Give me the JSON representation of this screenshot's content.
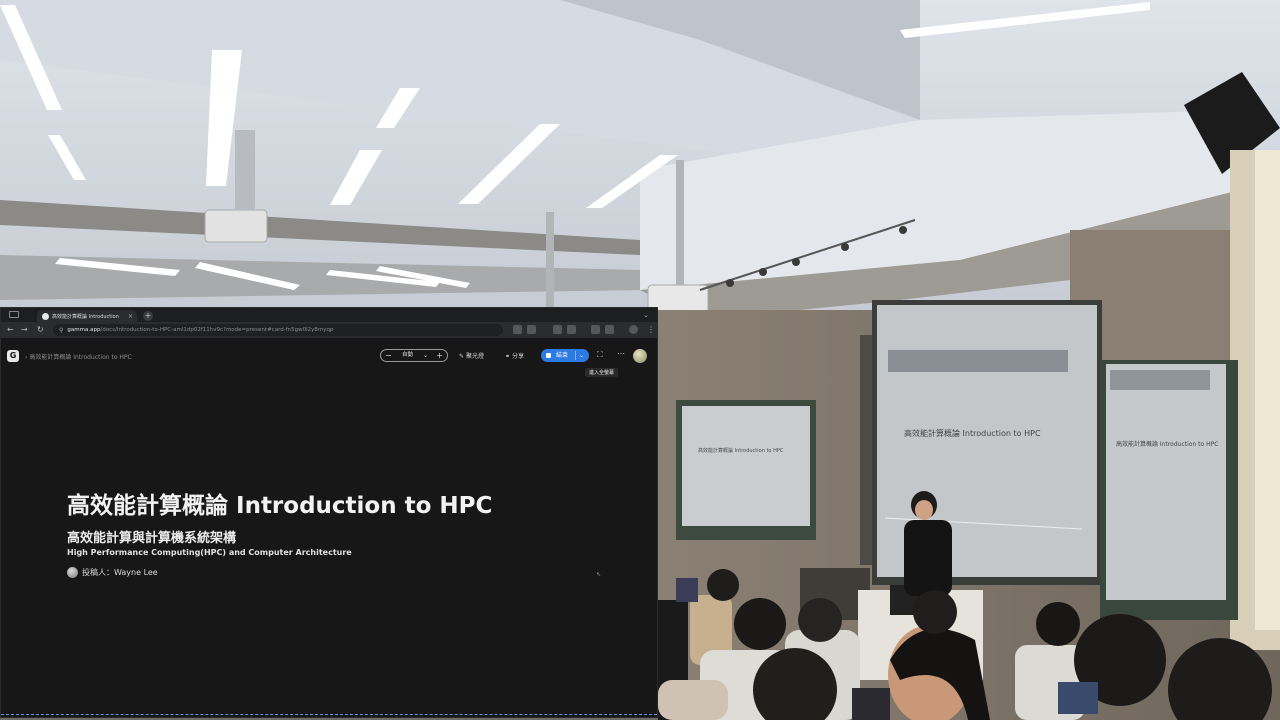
{
  "browser": {
    "tab_title": "高效能計算概論 Introduction",
    "new_tab_symbol": "+",
    "url_domain": "gamma.app",
    "url_path": "/docs/Introduction-to-HPC-aml1dp02f11hv9c?mode=present#card-fn5gw0l2y8myqp"
  },
  "app": {
    "logo": "G",
    "breadcrumb": "高效能計算概論 Introduction to HPC",
    "auto_label": "自動",
    "polish_label": "聚光燈",
    "share_label": "分享",
    "end_label": "結束",
    "tooltip": "進入全螢幕"
  },
  "slide": {
    "title": "高效能計算概論 Introduction to HPC",
    "subtitle_cn": "高效能計算與計算機系統架構",
    "subtitle_en": "High Performance Computing(HPC) and Computer Architecture",
    "presenter": "投稿人：Wayne Lee"
  },
  "projected": {
    "center_title": "高效能計算概論 Introduction to HPC",
    "left_title": "高效能計算概論 Introduction to HPC",
    "right_title": "高效能計算概論 Introduction to HPC"
  },
  "colors": {
    "accent": "#2c7be5",
    "slide_bg": "#171717"
  }
}
